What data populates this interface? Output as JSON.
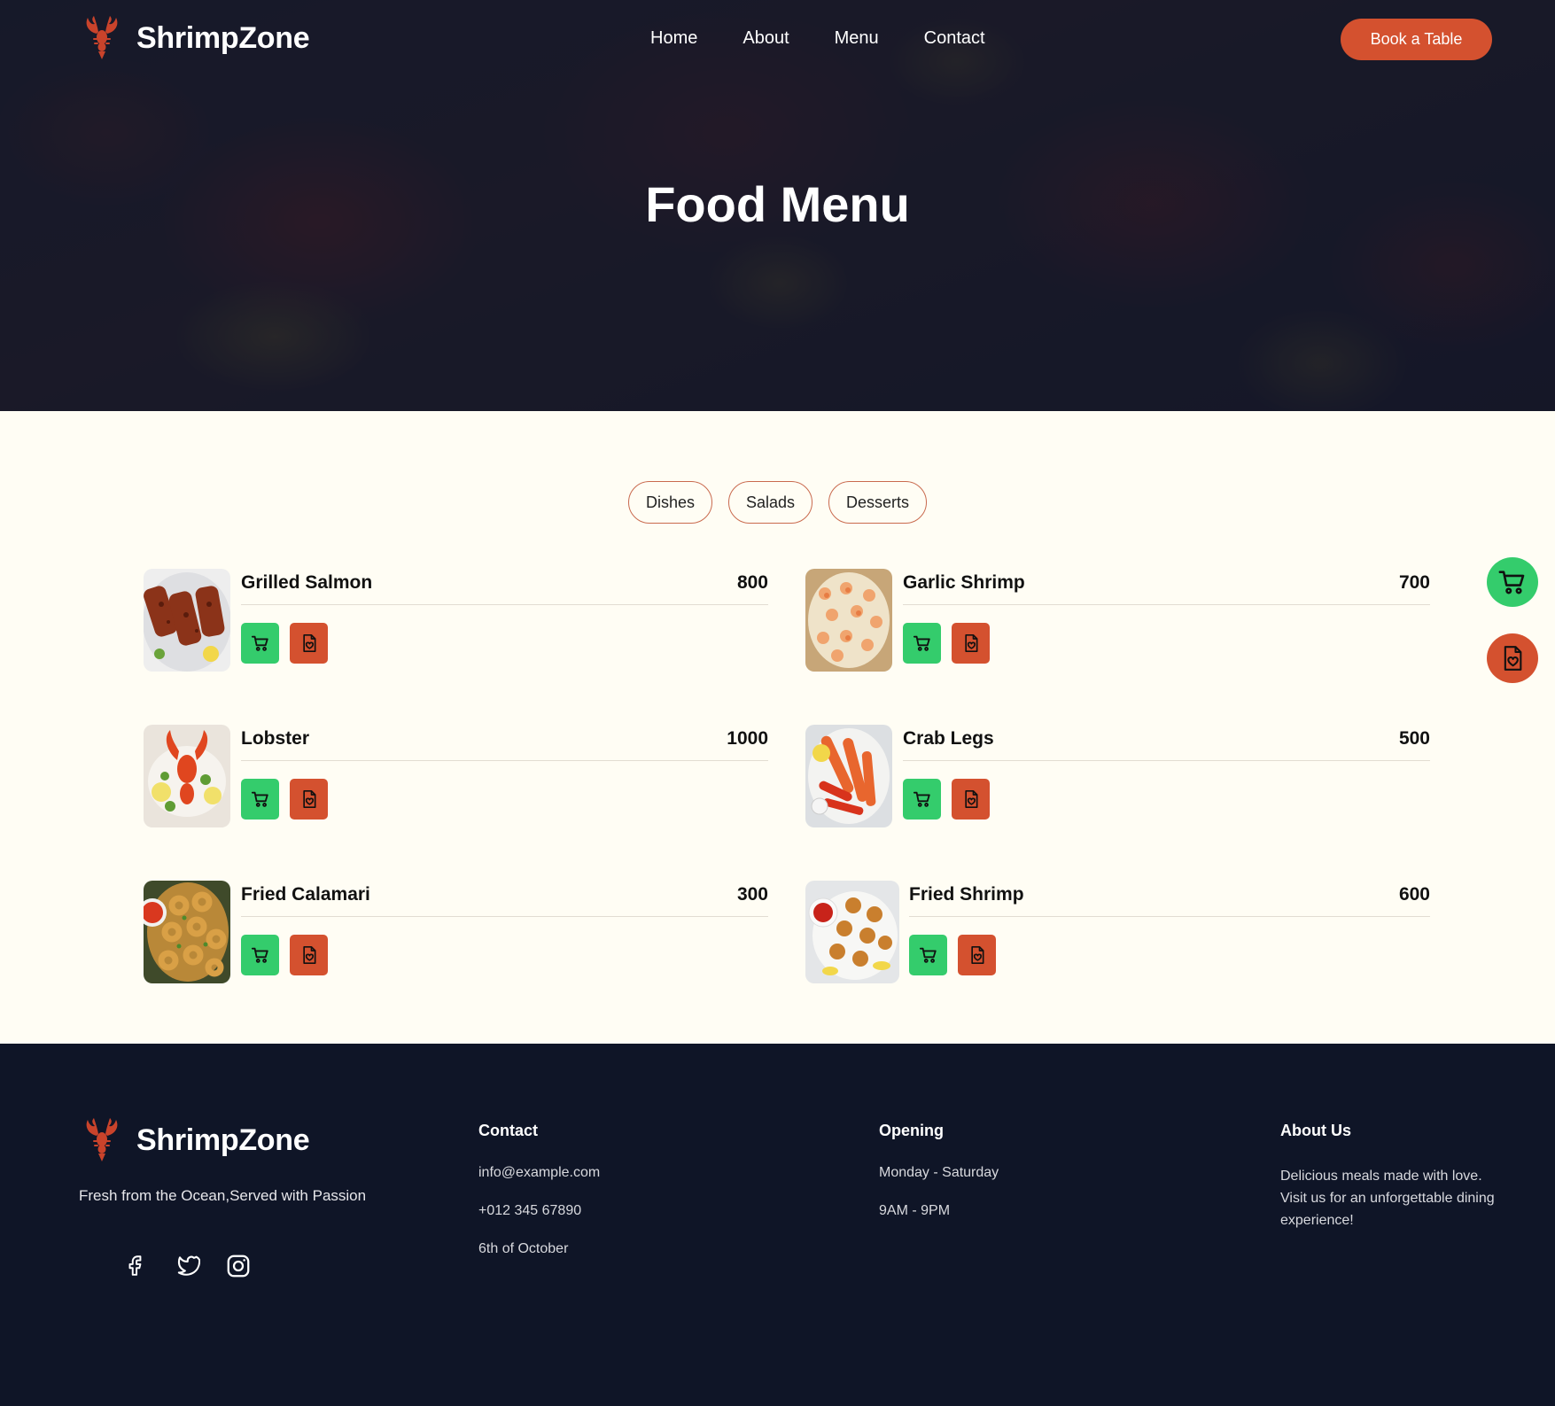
{
  "header": {
    "brand": "ShrimpZone",
    "nav": [
      "Home",
      "About",
      "Menu",
      "Contact"
    ],
    "cta": "Book a Table"
  },
  "hero": {
    "title": "Food Menu"
  },
  "menu": {
    "tabs": [
      "Dishes",
      "Salads",
      "Desserts"
    ],
    "items": [
      {
        "name": "Grilled Salmon",
        "price": "800"
      },
      {
        "name": "Garlic Shrimp",
        "price": "700"
      },
      {
        "name": "Lobster",
        "price": "1000"
      },
      {
        "name": "Crab Legs",
        "price": "500"
      },
      {
        "name": "Fried Calamari",
        "price": "300"
      },
      {
        "name": "Fried Shrimp",
        "price": "600"
      }
    ]
  },
  "floating": {
    "icons": [
      "cart-icon",
      "wishlist-icon"
    ]
  },
  "footer": {
    "brand": "ShrimpZone",
    "tagline": "Fresh from the Ocean,Served with Passion",
    "socials": [
      "facebook-icon",
      "twitter-icon",
      "instagram-icon"
    ],
    "contact": {
      "title": "Contact",
      "email": "info@example.com",
      "phone": "+012 345 67890",
      "address": "6th of October"
    },
    "opening": {
      "title": "Opening",
      "days": "Monday - Saturday",
      "hours": "9AM - 9PM"
    },
    "about": {
      "title": "About Us",
      "text": "Delicious meals made with love. Visit us for an unforgettable dining experience!"
    }
  },
  "colors": {
    "accent": "#d4512f",
    "cart": "#34cc6c",
    "footer_bg": "#0f1527",
    "page_bg": "#fffdf4"
  }
}
